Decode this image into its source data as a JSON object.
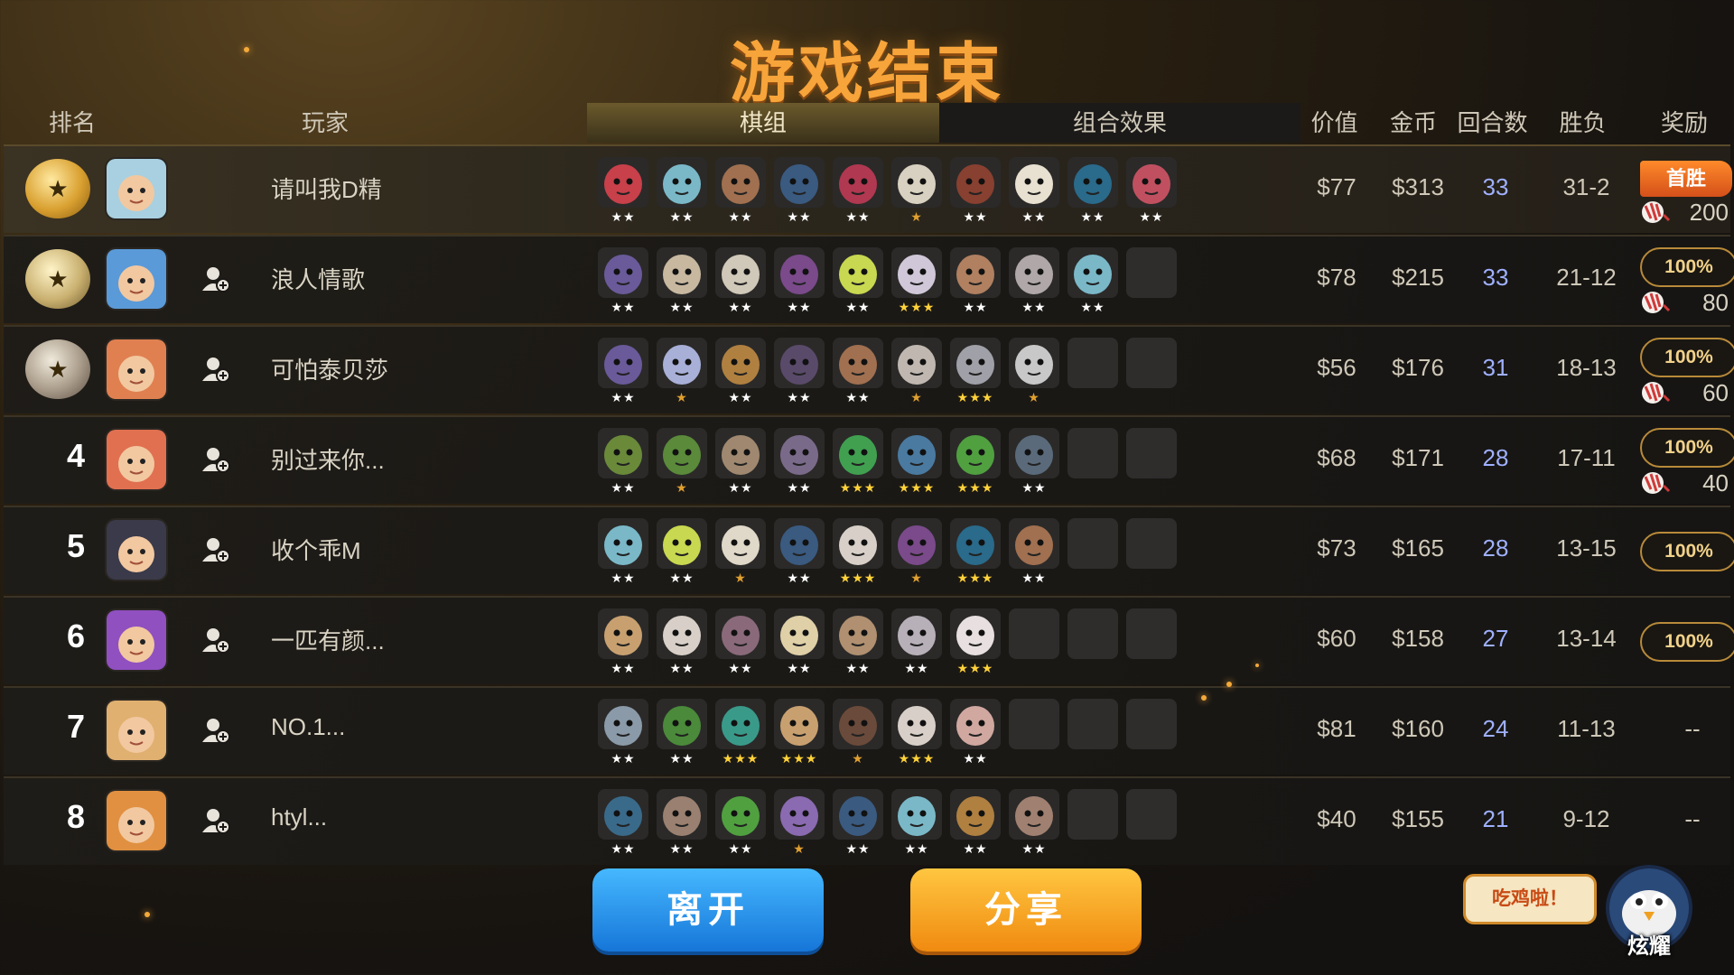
{
  "title": "游戏结束",
  "headers": {
    "rank": "排名",
    "player": "玩家",
    "deck": "棋组",
    "combo": "组合效果",
    "value": "价值",
    "gold": "金币",
    "rounds": "回合数",
    "win_loss": "胜负",
    "reward": "奖励"
  },
  "colors": {
    "title": "#f7a43a",
    "rounds": "#9fb0ff",
    "accent_gold": "#b88a3a"
  },
  "rows": [
    {
      "rank": "",
      "medal": "gold",
      "name": "请叫我D精",
      "value": "$77",
      "gold": "$313",
      "rounds": "33",
      "wl": "31-2",
      "reward_type": "first",
      "reward_label": "首胜",
      "reward_amount": "200",
      "pieces": [
        [
          "#c8404a",
          "w",
          2
        ],
        [
          "#7ab8c8",
          "w",
          2
        ],
        [
          "#a07050",
          "w",
          2
        ],
        [
          "#3a5a80",
          "w",
          2
        ],
        [
          "#b03850",
          "w",
          2
        ],
        [
          "#d8d0c0",
          "g",
          1
        ],
        [
          "#884030",
          "w",
          2
        ],
        [
          "#e8e0d0",
          "w",
          2
        ],
        [
          "#2a6a8a",
          "w",
          2
        ],
        [
          "#c05060",
          "w",
          2
        ]
      ]
    },
    {
      "rank": "",
      "medal": "silver",
      "name": "浪人情歌",
      "value": "$78",
      "gold": "$215",
      "rounds": "33",
      "wl": "21-12",
      "reward_type": "pct",
      "reward_label": "100%",
      "reward_amount": "80",
      "pieces": [
        [
          "#6a5a9a",
          "w",
          2
        ],
        [
          "#c8b8a0",
          "w",
          2
        ],
        [
          "#d0c8b8",
          "w",
          2
        ],
        [
          "#7a4a8a",
          "w",
          2
        ],
        [
          "#c8d850",
          "w",
          2
        ],
        [
          "#d0c8d8",
          "y",
          3
        ],
        [
          "#b08060",
          "w",
          2
        ],
        [
          "#b0a8a8",
          "w",
          2
        ],
        [
          "#7ab8c8",
          "w",
          2
        ],
        [
          "",
          "",
          0
        ]
      ]
    },
    {
      "rank": "",
      "medal": "bronze",
      "name": "可怕泰贝莎",
      "value": "$56",
      "gold": "$176",
      "rounds": "31",
      "wl": "18-13",
      "reward_type": "pct",
      "reward_label": "100%",
      "reward_amount": "60",
      "pieces": [
        [
          "#6a5a9a",
          "w",
          2
        ],
        [
          "#a8b0d8",
          "g",
          1
        ],
        [
          "#b08040",
          "w",
          2
        ],
        [
          "#5a4a6a",
          "w",
          2
        ],
        [
          "#a07050",
          "w",
          2
        ],
        [
          "#c0b8b0",
          "g",
          1
        ],
        [
          "#a0a0a8",
          "y",
          3
        ],
        [
          "#c8c8c8",
          "g",
          1
        ],
        [
          "",
          "",
          0
        ],
        [
          "",
          "",
          0
        ]
      ]
    },
    {
      "rank": "4",
      "medal": "",
      "name": "别过来你...",
      "value": "$68",
      "gold": "$171",
      "rounds": "28",
      "wl": "17-11",
      "reward_type": "pct",
      "reward_label": "100%",
      "reward_amount": "40",
      "pieces": [
        [
          "#6a8a3a",
          "w",
          2
        ],
        [
          "#5a8a3a",
          "g",
          1
        ],
        [
          "#a08870",
          "w",
          2
        ],
        [
          "#7a6a8a",
          "w",
          2
        ],
        [
          "#40a050",
          "y",
          3
        ],
        [
          "#4a7aa0",
          "y",
          3
        ],
        [
          "#50a040",
          "y",
          3
        ],
        [
          "#5a6a7a",
          "w",
          2
        ],
        [
          "",
          "",
          0
        ],
        [
          "",
          "",
          0
        ]
      ]
    },
    {
      "rank": "5",
      "medal": "",
      "name": "收个乖M",
      "value": "$73",
      "gold": "$165",
      "rounds": "28",
      "wl": "13-15",
      "reward_type": "pct_only",
      "reward_label": "100%",
      "reward_amount": "",
      "pieces": [
        [
          "#7ab8c8",
          "w",
          2
        ],
        [
          "#c8d850",
          "w",
          2
        ],
        [
          "#e0d8c8",
          "g",
          1
        ],
        [
          "#3a5a80",
          "w",
          2
        ],
        [
          "#d8d0c8",
          "y",
          3
        ],
        [
          "#7a4a8a",
          "g",
          1
        ],
        [
          "#2a6a8a",
          "y",
          3
        ],
        [
          "#a07050",
          "w",
          2
        ],
        [
          "",
          "",
          0
        ],
        [
          "",
          "",
          0
        ]
      ]
    },
    {
      "rank": "6",
      "medal": "",
      "name": "一匹有颜...",
      "value": "$60",
      "gold": "$158",
      "rounds": "27",
      "wl": "13-14",
      "reward_type": "pct_only",
      "reward_label": "100%",
      "reward_amount": "",
      "pieces": [
        [
          "#c8a070",
          "w",
          2
        ],
        [
          "#d8d0c8",
          "w",
          2
        ],
        [
          "#8a6a7a",
          "w",
          2
        ],
        [
          "#e0d0a8",
          "w",
          2
        ],
        [
          "#b09070",
          "w",
          2
        ],
        [
          "#b8b0b8",
          "w",
          2
        ],
        [
          "#e8e0e0",
          "y",
          3
        ],
        [
          "",
          "",
          0
        ],
        [
          "",
          "",
          0
        ],
        [
          "",
          "",
          0
        ]
      ]
    },
    {
      "rank": "7",
      "medal": "",
      "name": "NO.1...",
      "value": "$81",
      "gold": "$160",
      "rounds": "24",
      "wl": "11-13",
      "reward_type": "none",
      "reward_label": "--",
      "reward_amount": "",
      "pieces": [
        [
          "#8a9aa8",
          "w",
          2
        ],
        [
          "#4a8a3a",
          "w",
          2
        ],
        [
          "#3a9a8a",
          "y",
          3
        ],
        [
          "#c8a070",
          "y",
          3
        ],
        [
          "#6a4a3a",
          "g",
          1
        ],
        [
          "#d8d0c8",
          "y",
          3
        ],
        [
          "#d0a8a0",
          "w",
          2
        ],
        [
          "",
          "",
          0
        ],
        [
          "",
          "",
          0
        ],
        [
          "",
          "",
          0
        ]
      ]
    },
    {
      "rank": "8",
      "medal": "",
      "name": "htyl...",
      "value": "$40",
      "gold": "$155",
      "rounds": "21",
      "wl": "9-12",
      "reward_type": "none",
      "reward_label": "--",
      "reward_amount": "",
      "pieces": [
        [
          "#3a6a8a",
          "w",
          2
        ],
        [
          "#9a8070",
          "w",
          2
        ],
        [
          "#50a040",
          "w",
          2
        ],
        [
          "#8a6ab0",
          "g",
          1
        ],
        [
          "#3a5a80",
          "w",
          2
        ],
        [
          "#7ab8c8",
          "w",
          2
        ],
        [
          "#b08040",
          "w",
          2
        ],
        [
          "#a08070",
          "w",
          2
        ],
        [
          "",
          "",
          0
        ],
        [
          "",
          "",
          0
        ]
      ]
    }
  ],
  "avatars": [
    "#a8d0e0",
    "#5a9ad8",
    "#e08050",
    "#e07050",
    "#3a3a4a",
    "#9050c0",
    "#e0b070",
    "#e09040"
  ],
  "buttons": {
    "leave": "离开",
    "share": "分享"
  },
  "bubble": "吃鸡啦！",
  "mascot_label": "炫耀"
}
